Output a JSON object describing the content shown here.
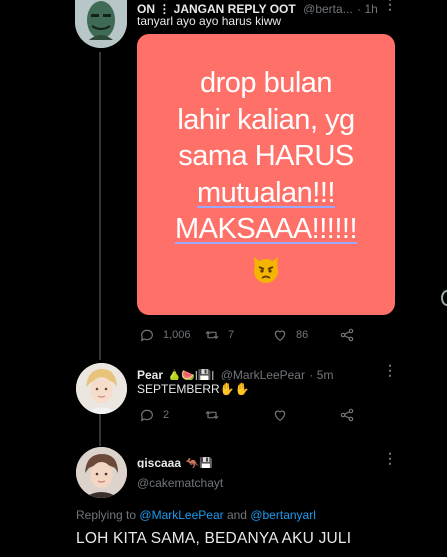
{
  "tweet1": {
    "name": "ON ⋮ JANGAN REPLY OOT",
    "handle": "@berta...",
    "time": "1h",
    "text": "tanyarl ayo ayo harus kiww",
    "media_lines": [
      "drop bulan",
      "lahir kalian, yg",
      "sama HARUS",
      "mutualan!!!",
      "MAKSAAA!!!!!!"
    ],
    "replies": "1,006",
    "retweets": "7",
    "likes": "86"
  },
  "tweet2": {
    "name": "Pear",
    "name_emojis": "🍐🍉|💾|",
    "handle": "@MarkLeePear",
    "time": "5m",
    "text": "SEPTEMBERR",
    "text_emojis": "✋✋",
    "replies": "2"
  },
  "tweet3": {
    "name": "giscaaa",
    "name_emojis": "🦘💾",
    "handle": "@cakematchayt"
  },
  "replying": {
    "prefix": "Replying to",
    "user1": "@MarkLeePear",
    "and": "and",
    "user2": "@bertanyarl"
  },
  "compose_text": "LOH KITA SAMA, BEDANYA AKU JULI",
  "colors": {
    "background": "#000000",
    "media": "#fe7068",
    "link": "#1d9bf0",
    "muted": "#71767b"
  }
}
